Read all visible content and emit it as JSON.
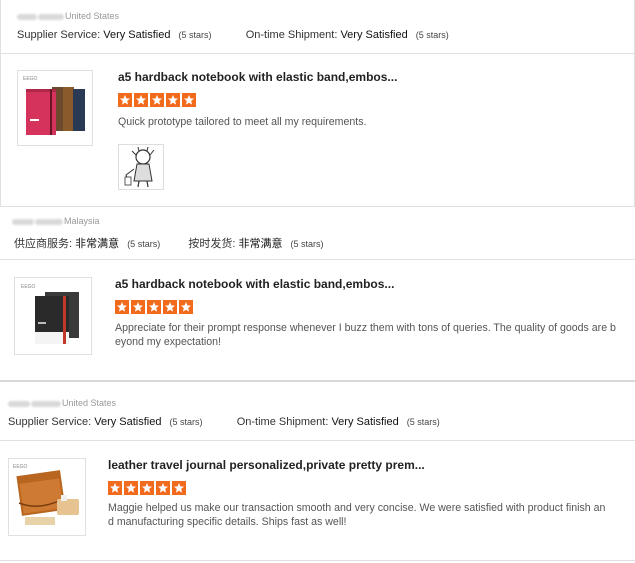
{
  "reviews": [
    {
      "buyer_country": "United States",
      "ratings": {
        "supplier_label": "Supplier Service:",
        "supplier_value": "Very Satisfied",
        "supplier_stars": "(5 stars)",
        "shipment_label": "On-time Shipment:",
        "shipment_value": "Very Satisfied",
        "shipment_stars": "(5 stars)"
      },
      "product_title": "a5 hardback notebook with elastic band,embos...",
      "star_count": 5,
      "comment": "Quick prototype tailored to meet all my requirements.",
      "thumb_icon": "notebooks-red-brown-icon",
      "attachment_icon": "character-sketch-icon"
    },
    {
      "buyer_country": "Malaysia",
      "ratings": {
        "supplier_label": "供应商服务:",
        "supplier_value": "非常满意",
        "supplier_stars": "(5 stars)",
        "shipment_label": "按时发货:",
        "shipment_value": "非常满意",
        "shipment_stars": "(5 stars)"
      },
      "product_title": "a5 hardback notebook with elastic band,embos...",
      "star_count": 5,
      "comment_line1": "Appreciate for their prompt response whenever I buzz them with tons of queries. The quality of goods are b",
      "comment_line2": "eyond my expectation!",
      "thumb_icon": "notebook-dark-icon"
    },
    {
      "buyer_country": "United States",
      "ratings": {
        "supplier_label": "Supplier Service:",
        "supplier_value": "Very Satisfied",
        "supplier_stars": "(5 stars)",
        "shipment_label": "On-time Shipment:",
        "shipment_value": "Very Satisfied",
        "shipment_stars": "(5 stars)"
      },
      "product_title": "leather travel journal personalized,private pretty prem...",
      "star_count": 5,
      "comment_line1": "Maggie helped us make our transaction smooth and very concise. We were satisfied with product finish an",
      "comment_line2": "d manufacturing specific details. Ships fast as well!",
      "thumb_icon": "leather-journal-icon"
    }
  ],
  "colors": {
    "star": "#f26b1d",
    "border": "#e0e0e0",
    "muted": "#999999"
  }
}
